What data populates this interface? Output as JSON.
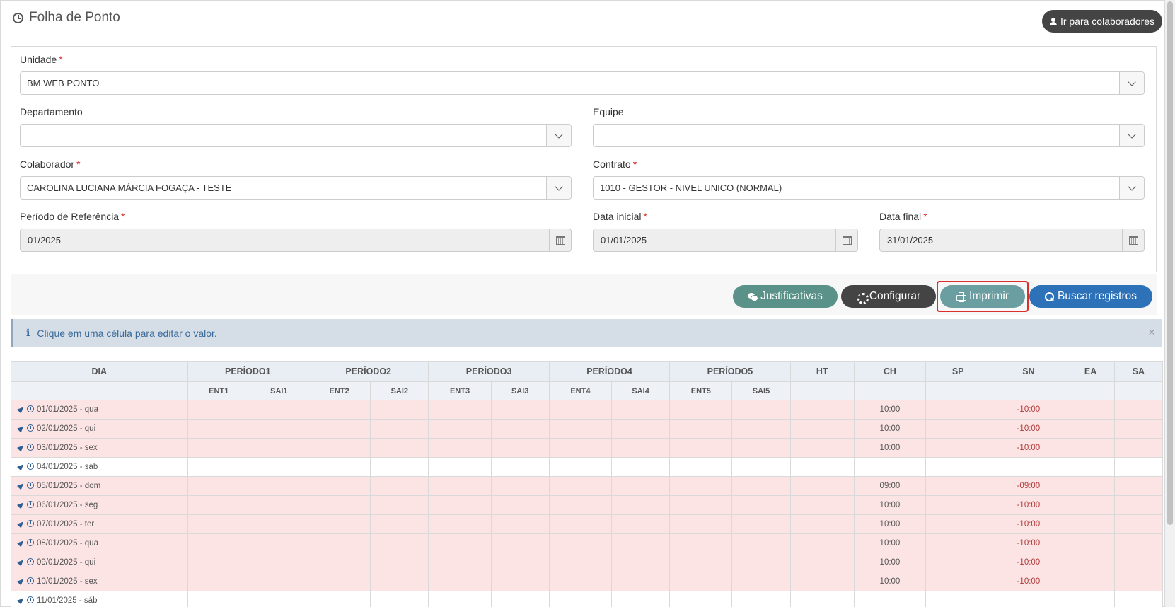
{
  "header": {
    "title": "Folha de Ponto",
    "colab_button": "Ir para colaboradores"
  },
  "form": {
    "unidade": {
      "label": "Unidade",
      "required": "*",
      "value": "BM WEB PONTO"
    },
    "departamento": {
      "label": "Departamento",
      "value": ""
    },
    "equipe": {
      "label": "Equipe",
      "value": ""
    },
    "colaborador": {
      "label": "Colaborador",
      "required": "*",
      "value": "CAROLINA LUCIANA MÁRCIA FOGAÇA - TESTE"
    },
    "contrato": {
      "label": "Contrato",
      "required": "*",
      "value": "1010 - GESTOR - NIVEL UNICO (NORMAL)"
    },
    "periodo": {
      "label": "Período de Referência",
      "required": "*",
      "value": "01/2025"
    },
    "data_inicial": {
      "label": "Data inicial",
      "required": "*",
      "value": "01/01/2025"
    },
    "data_final": {
      "label": "Data final",
      "required": "*",
      "value": "31/01/2025"
    }
  },
  "toolbar": {
    "justificativas": "Justificativas",
    "configurar": "Configurar",
    "imprimir": "Imprimir",
    "buscar": "Buscar registros"
  },
  "alert": {
    "text": "Clique em uma célula para editar o valor.",
    "close": "×"
  },
  "colors": {
    "absent_row": "#fde4e4",
    "primary": "#2d72b8",
    "highlight": "#d9302c"
  },
  "table": {
    "header1": [
      "DIA",
      "PERÍODO1",
      "PERÍODO2",
      "PERÍODO3",
      "PERÍODO4",
      "PERÍODO5",
      "HT",
      "CH",
      "SP",
      "SN",
      "EA",
      "SA"
    ],
    "header2": [
      "ENT1",
      "SAI1",
      "ENT2",
      "SAI2",
      "ENT3",
      "SAI3",
      "ENT4",
      "SAI4",
      "ENT5",
      "SAI5"
    ],
    "rows": [
      {
        "day": "01/01/2025 - qua",
        "ch": "10:00",
        "sn": "-10:00",
        "absent": true
      },
      {
        "day": "02/01/2025 - qui",
        "ch": "10:00",
        "sn": "-10:00",
        "absent": true
      },
      {
        "day": "03/01/2025 - sex",
        "ch": "10:00",
        "sn": "-10:00",
        "absent": true
      },
      {
        "day": "04/01/2025 - sáb",
        "ch": "",
        "sn": "",
        "absent": false
      },
      {
        "day": "05/01/2025 - dom",
        "ch": "09:00",
        "sn": "-09:00",
        "absent": true
      },
      {
        "day": "06/01/2025 - seg",
        "ch": "10:00",
        "sn": "-10:00",
        "absent": true
      },
      {
        "day": "07/01/2025 - ter",
        "ch": "10:00",
        "sn": "-10:00",
        "absent": true
      },
      {
        "day": "08/01/2025 - qua",
        "ch": "10:00",
        "sn": "-10:00",
        "absent": true
      },
      {
        "day": "09/01/2025 - qui",
        "ch": "10:00",
        "sn": "-10:00",
        "absent": true
      },
      {
        "day": "10/01/2025 - sex",
        "ch": "10:00",
        "sn": "-10:00",
        "absent": true
      },
      {
        "day": "11/01/2025 - sáb",
        "ch": "",
        "sn": "",
        "absent": false
      }
    ]
  }
}
